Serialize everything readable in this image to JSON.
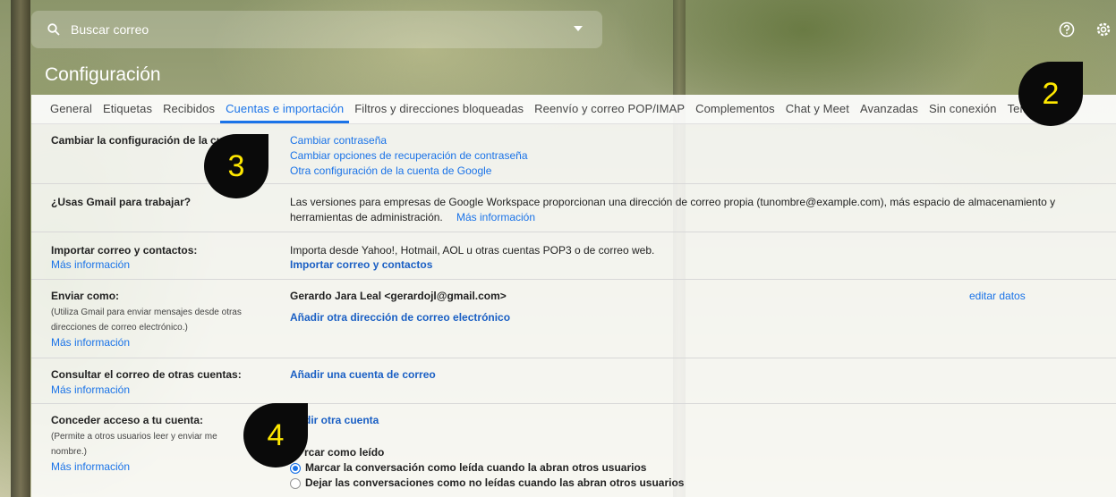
{
  "search": {
    "placeholder": "Buscar correo"
  },
  "header": {
    "title": "Configuración"
  },
  "tabs": [
    {
      "label": "General"
    },
    {
      "label": "Etiquetas"
    },
    {
      "label": "Recibidos"
    },
    {
      "label": "Cuentas e importación",
      "active": true
    },
    {
      "label": "Filtros y direcciones bloqueadas"
    },
    {
      "label": "Reenvío y correo POP/IMAP"
    },
    {
      "label": "Complementos"
    },
    {
      "label": "Chat y Meet"
    },
    {
      "label": "Avanzadas"
    },
    {
      "label": "Sin conexión"
    },
    {
      "label": "Temas"
    }
  ],
  "sections": {
    "change_settings": {
      "label": "Cambiar la configuración de la cuenta:",
      "links": [
        "Cambiar contraseña",
        "Cambiar opciones de recuperación de contraseña",
        "Otra configuración de la cuenta de Google"
      ]
    },
    "work": {
      "label": "¿Usas Gmail para trabajar?",
      "text": "Las versiones para empresas de Google Workspace proporcionan una dirección de correo propia (tunombre@example.com), más espacio de almacenamiento y",
      "text2": "herramientas de administración.",
      "more": "Más información"
    },
    "import": {
      "label": "Importar correo y contactos:",
      "more": "Más información",
      "text": "Importa desde Yahoo!, Hotmail, AOL u otras cuentas POP3 o de correo web.",
      "action": "Importar correo y contactos"
    },
    "send_as": {
      "label": "Enviar como:",
      "sub1": "(Utiliza Gmail para enviar mensajes desde otras",
      "sub2": "direcciones de correo electrónico.)",
      "more": "Más información",
      "address": "Gerardo Jara Leal <gerardojl@gmail.com>",
      "edit": "editar datos",
      "action": "Añadir otra dirección de correo electrónico"
    },
    "check_mail": {
      "label": "Consultar el correo de otras cuentas:",
      "more": "Más información",
      "action": "Añadir una cuenta de correo"
    },
    "grant": {
      "label": "Conceder acceso a tu cuenta:",
      "sub1": "(Permite a otros usuarios leer y enviar me",
      "sub2": "nombre.)",
      "more": "Más información",
      "action": "dir otra cuenta",
      "mark_label": "rcar como leído",
      "option1": "Marcar la conversación como leída cuando la abran otros usuarios",
      "option2": "Dejar las conversaciones como no leídas cuando las abran otros usuarios"
    }
  },
  "badges": [
    "2",
    "3",
    "4"
  ],
  "colors": {
    "accent": "#1a73e8",
    "badge_bg": "#0a0a0a",
    "badge_text": "#ffe800"
  }
}
